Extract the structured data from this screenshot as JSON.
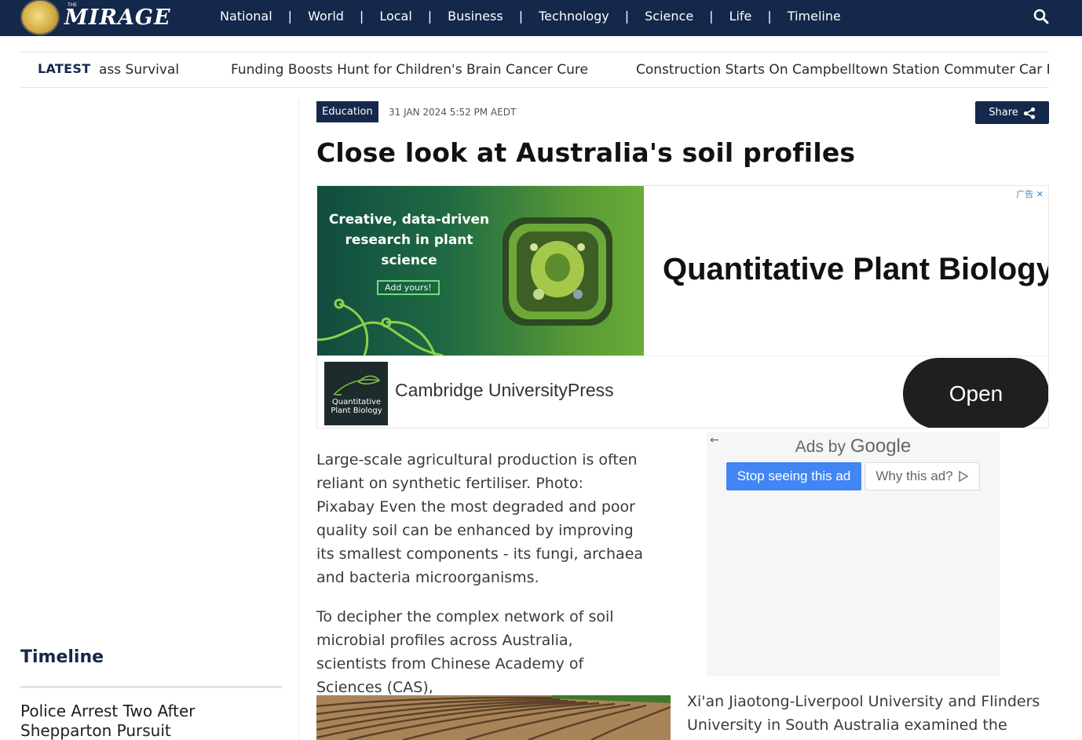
{
  "nav": {
    "logo_small": "THE",
    "logo_text": "MIRAGE",
    "items": [
      {
        "label": "National"
      },
      {
        "label": "World"
      },
      {
        "label": "Local"
      },
      {
        "label": "Business"
      },
      {
        "label": "Technology"
      },
      {
        "label": "Science"
      },
      {
        "label": "Life"
      },
      {
        "label": "Timeline"
      }
    ],
    "separator": "|",
    "search_icon": "search-icon",
    "background_color": "#14284b"
  },
  "ticker": {
    "label": "LATEST",
    "items": [
      {
        "text": "ass Survival"
      },
      {
        "text": "Funding Boosts Hunt for Children's Brain Cancer Cure"
      },
      {
        "text": "Construction Starts On Campbelltown Station Commuter Car Pa"
      }
    ]
  },
  "sidebar": {
    "heading": "Timeline",
    "story": "Police Arrest Two After Shepparton Pursuit"
  },
  "article": {
    "category": "Education",
    "date": "31 JAN 2024 5:52 PM AEDT",
    "share_label": "Share",
    "title": "Close look at Australia's soil profiles",
    "paragraph1": "Large-scale agricultural production is often reliant on synthetic fertiliser. Photo: Pixabay Even the most degraded and poor quality soil can be enhanced by improving its smallest components - its fungi, archaea and bacteria microorganisms.",
    "paragraph2": "To decipher the complex network of soil microbial profiles across Australia, scientists from Chinese Academy of Sciences (CAS),",
    "paragraph2_cont": "Xi'an Jiaotong-Liverpool University and Flinders University in South Australia examined the"
  },
  "ad_top": {
    "banner_headline": "Creative, data-driven research in plant science",
    "banner_button": "Add yours!",
    "adchoices": "广告 ✕",
    "headline": "Quantitative Plant Biology",
    "journal_thumb": "Quantitative Plant Biology",
    "advertiser": "Cambridge UniversityPress",
    "open_button": "Open"
  },
  "ad_side": {
    "back_icon": "←",
    "label_prefix": "Ads by",
    "label_brand": "Google",
    "stop_button": "Stop seeing this ad",
    "why_button": "Why this ad?",
    "accent_color": "#4285f4"
  }
}
